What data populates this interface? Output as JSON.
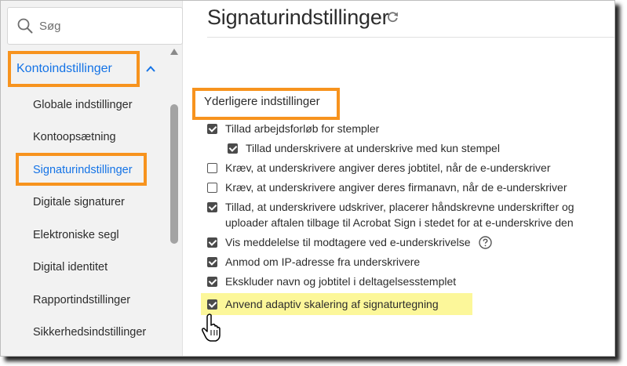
{
  "sidebar": {
    "search_placeholder": "Søg",
    "section_label": "Kontoindstillinger",
    "items": [
      {
        "label": "Globale indstillinger"
      },
      {
        "label": "Kontoopsætning"
      },
      {
        "label": "Signaturindstillinger",
        "active": true
      },
      {
        "label": "Digitale signaturer"
      },
      {
        "label": "Elektroniske segl"
      },
      {
        "label": "Digital identitet"
      },
      {
        "label": "Rapportindstillinger"
      },
      {
        "label": "Sikkerhedsindstillinger"
      }
    ]
  },
  "main": {
    "title": "Signaturindstillinger",
    "section_title": "Yderligere indstillinger",
    "options": [
      {
        "label": "Tillad arbejdsforløb for stempler",
        "checked": true
      },
      {
        "label": "Tillad underskrivere at underskrive med kun stempel",
        "checked": true
      },
      {
        "label": "Kræv, at underskrivere angiver deres jobtitel, når de e-underskriver",
        "checked": false
      },
      {
        "label": "Kræv, at underskrivere angiver deres firmanavn, når de e-underskriver",
        "checked": false
      },
      {
        "label": "Tillad, at underskrivere udskriver, placerer håndskrevne underskrifter og uploader aftalen tilbage til Acrobat Sign i stedet for at e-underskrive den",
        "checked": true
      },
      {
        "label": "Vis meddelelse til modtagere ved e-underskrivelse",
        "checked": true
      },
      {
        "label": "Anmod om IP-adresse fra underskrivere",
        "checked": true
      },
      {
        "label": "Ekskluder navn og jobtitel i deltagelsesstemplet",
        "checked": true
      },
      {
        "label": "Anvend adaptiv skalering af signaturtegning",
        "checked": true
      }
    ]
  },
  "colors": {
    "accent": "#1473e6",
    "callout": "#f7931e",
    "highlight": "#fcf79a"
  },
  "icons": [
    "search-icon",
    "chevron-up-icon",
    "refresh-icon",
    "help-icon",
    "hand-cursor-icon"
  ]
}
